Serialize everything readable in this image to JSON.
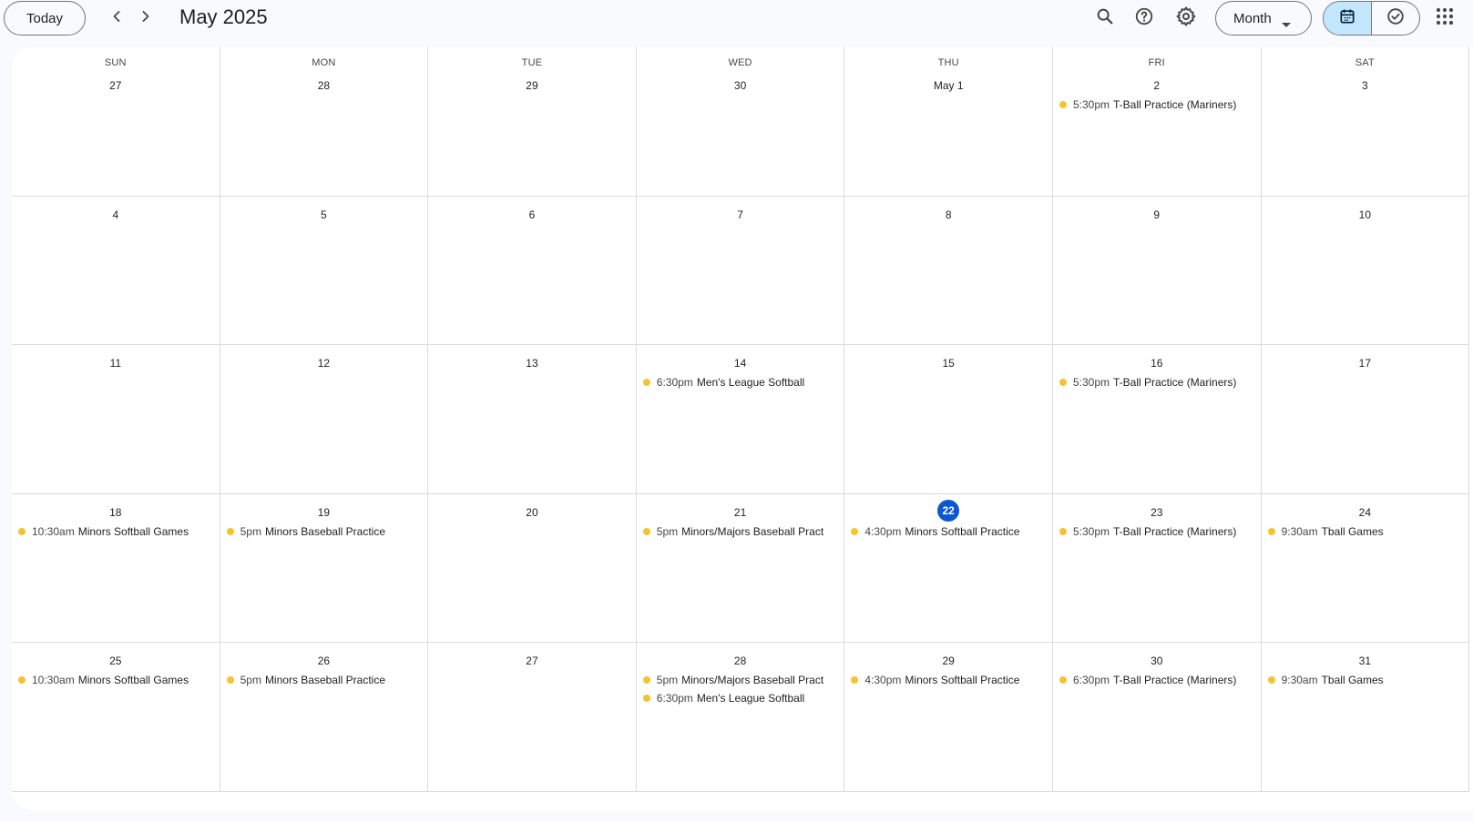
{
  "toolbar": {
    "today_label": "Today",
    "month_title": "May 2025",
    "view_label": "Month",
    "icons": [
      "chevron-left-icon",
      "chevron-right-icon",
      "search-icon",
      "help-icon",
      "gear-icon",
      "caret-down-icon",
      "calendar-icon",
      "tasks-check-icon",
      "apps-grid-icon"
    ]
  },
  "colors": {
    "event_dot": "#f4c430",
    "today_circle": "#0b57d0",
    "toggle_active": "#c2e7ff"
  },
  "days_of_week": [
    "SUN",
    "MON",
    "TUE",
    "WED",
    "THU",
    "FRI",
    "SAT"
  ],
  "weeks": [
    [
      {
        "date": "27",
        "events": []
      },
      {
        "date": "28",
        "events": []
      },
      {
        "date": "29",
        "events": []
      },
      {
        "date": "30",
        "events": []
      },
      {
        "date": "May 1",
        "events": []
      },
      {
        "date": "2",
        "events": [
          {
            "time": "5:30pm",
            "title": "T-Ball Practice (Mariners)"
          }
        ]
      },
      {
        "date": "3",
        "events": []
      }
    ],
    [
      {
        "date": "4",
        "events": []
      },
      {
        "date": "5",
        "events": []
      },
      {
        "date": "6",
        "events": []
      },
      {
        "date": "7",
        "events": []
      },
      {
        "date": "8",
        "events": []
      },
      {
        "date": "9",
        "events": []
      },
      {
        "date": "10",
        "events": []
      }
    ],
    [
      {
        "date": "11",
        "events": []
      },
      {
        "date": "12",
        "events": []
      },
      {
        "date": "13",
        "events": []
      },
      {
        "date": "14",
        "events": [
          {
            "time": "6:30pm",
            "title": "Men's League Softball"
          }
        ]
      },
      {
        "date": "15",
        "events": []
      },
      {
        "date": "16",
        "events": [
          {
            "time": "5:30pm",
            "title": "T-Ball Practice (Mariners)"
          }
        ]
      },
      {
        "date": "17",
        "events": []
      }
    ],
    [
      {
        "date": "18",
        "events": [
          {
            "time": "10:30am",
            "title": "Minors Softball Games"
          }
        ]
      },
      {
        "date": "19",
        "events": [
          {
            "time": "5pm",
            "title": "Minors Baseball Practice"
          }
        ]
      },
      {
        "date": "20",
        "events": []
      },
      {
        "date": "21",
        "events": [
          {
            "time": "5pm",
            "title": "Minors/Majors Baseball Pract"
          }
        ]
      },
      {
        "date": "22",
        "today": true,
        "events": [
          {
            "time": "4:30pm",
            "title": "Minors Softball Practice"
          }
        ]
      },
      {
        "date": "23",
        "events": [
          {
            "time": "5:30pm",
            "title": "T-Ball Practice (Mariners)"
          }
        ]
      },
      {
        "date": "24",
        "events": [
          {
            "time": "9:30am",
            "title": "Tball Games"
          }
        ]
      }
    ],
    [
      {
        "date": "25",
        "events": [
          {
            "time": "10:30am",
            "title": "Minors Softball Games"
          }
        ]
      },
      {
        "date": "26",
        "events": [
          {
            "time": "5pm",
            "title": "Minors Baseball Practice"
          }
        ]
      },
      {
        "date": "27",
        "events": []
      },
      {
        "date": "28",
        "events": [
          {
            "time": "5pm",
            "title": "Minors/Majors Baseball Pract"
          },
          {
            "time": "6:30pm",
            "title": "Men's League Softball"
          }
        ]
      },
      {
        "date": "29",
        "events": [
          {
            "time": "4:30pm",
            "title": "Minors Softball Practice"
          }
        ]
      },
      {
        "date": "30",
        "events": [
          {
            "time": "6:30pm",
            "title": "T-Ball Practice (Mariners)"
          }
        ]
      },
      {
        "date": "31",
        "events": [
          {
            "time": "9:30am",
            "title": "Tball Games"
          }
        ]
      }
    ]
  ]
}
